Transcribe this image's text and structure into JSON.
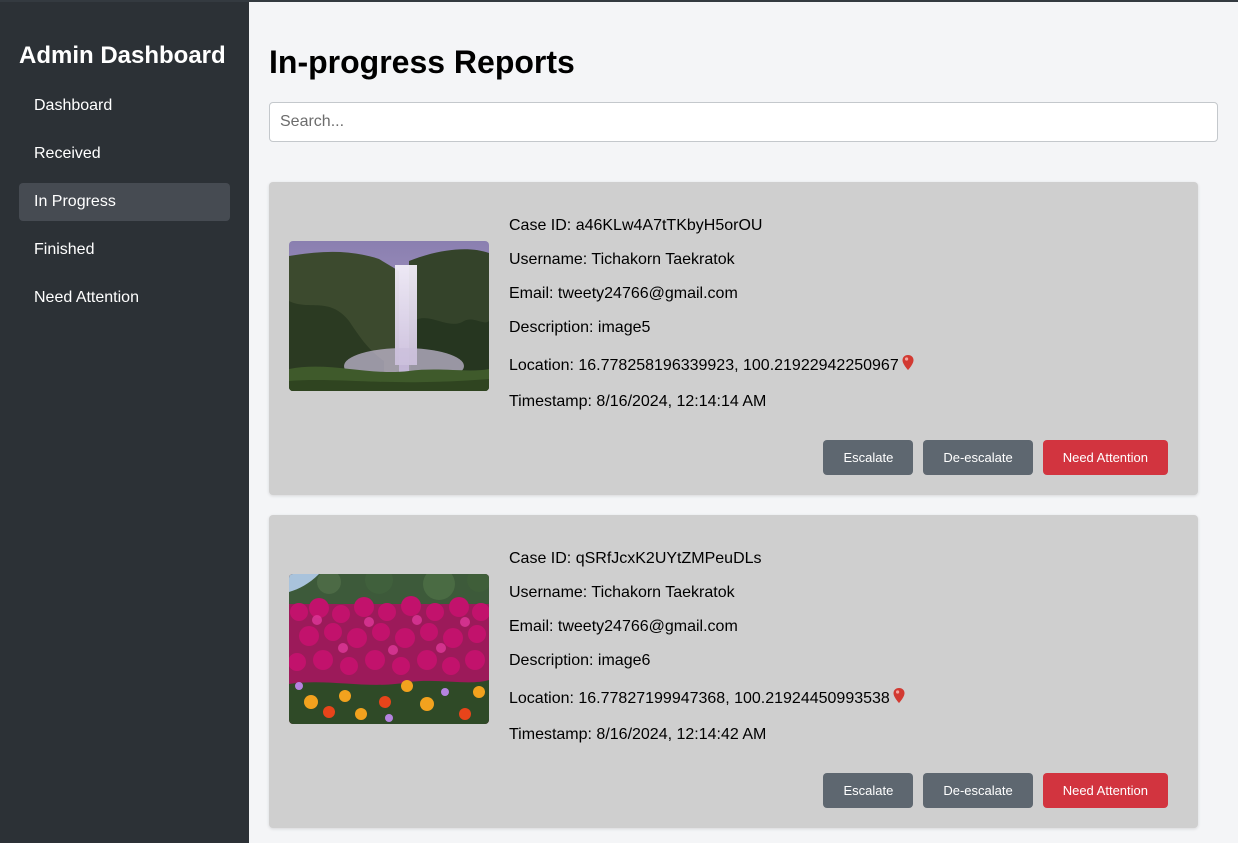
{
  "sidebar": {
    "title": "Admin Dashboard",
    "items": [
      {
        "label": "Dashboard"
      },
      {
        "label": "Received"
      },
      {
        "label": "In Progress"
      },
      {
        "label": "Finished"
      },
      {
        "label": "Need Attention"
      }
    ],
    "active": "In Progress"
  },
  "main": {
    "title": "In-progress Reports",
    "search": {
      "placeholder": "Search...",
      "value": ""
    }
  },
  "reports": [
    {
      "case_id": "Case ID: a46KLw4A7tTKbyH5orOU",
      "username": "Username: Tichakorn Taekratok",
      "email": "Email: tweety24766@gmail.com",
      "description": "Description: image5",
      "location": "Location: 16.778258196339923, 100.21922942250967",
      "timestamp": "Timestamp: 8/16/2024, 12:14:14 AM",
      "image": "waterfall-photo"
    },
    {
      "case_id": "Case ID: qSRfJcxK2UYtZMPeuDLs",
      "username": "Username: Tichakorn Taekratok",
      "email": "Email: tweety24766@gmail.com",
      "description": "Description: image6",
      "location": "Location: 16.77827199947368, 100.21924450993538",
      "timestamp": "Timestamp: 8/16/2024, 12:14:42 AM",
      "image": "flowers-photo"
    }
  ],
  "actions": {
    "escalate": "Escalate",
    "deescalate": "De-escalate",
    "need_attention": "Need Attention"
  },
  "icons": {
    "location": "map-pin-icon"
  },
  "colors": {
    "sidebar_bg": "#2c3136",
    "active_item": "#464b52",
    "card_bg": "#cfcfcf",
    "gray_button": "#5e6770",
    "red_button": "#d2343f",
    "pin": "#d23a32"
  }
}
